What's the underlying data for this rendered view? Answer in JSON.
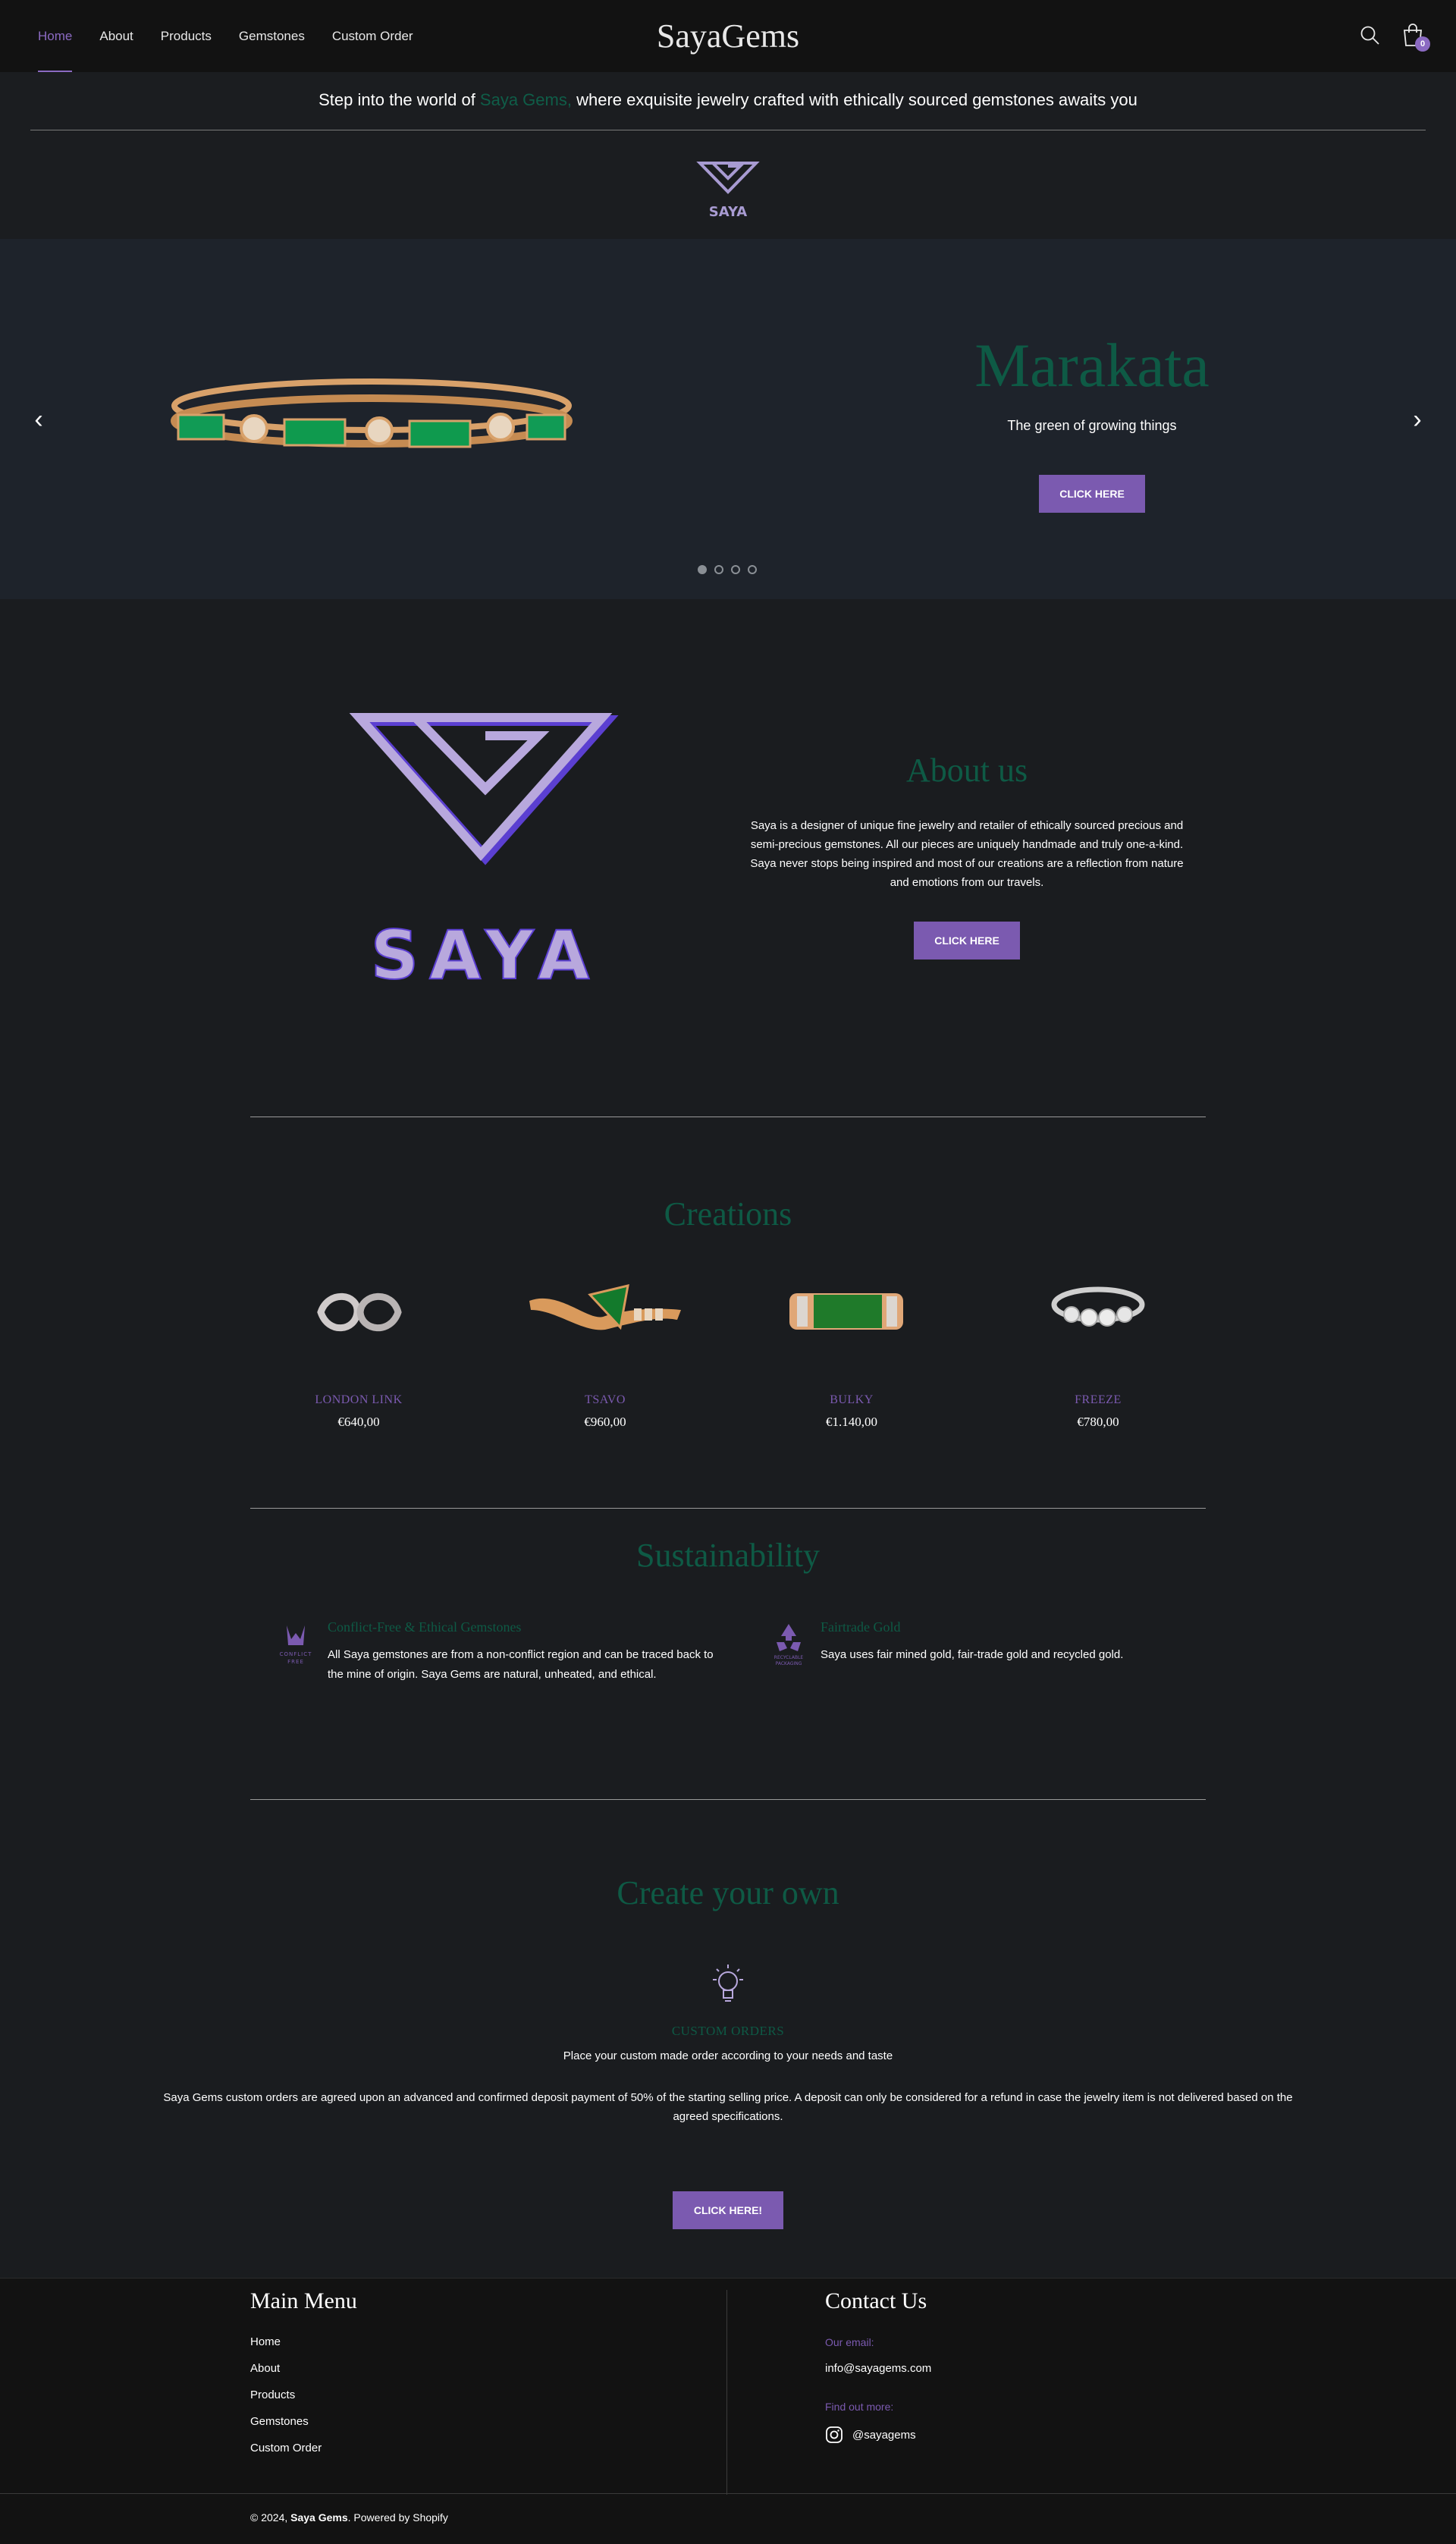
{
  "header": {
    "nav": [
      "Home",
      "About",
      "Products",
      "Gemstones",
      "Custom Order"
    ],
    "brand": "SayaGems",
    "cart_count": "0",
    "icons": [
      "search-icon",
      "cart-icon"
    ]
  },
  "announcement": {
    "pre": "Step into the world of ",
    "highlight": "Saya Gems,",
    "post": " where exquisite jewelry crafted with ethically sourced gemstones awaits you",
    "logo_text": "SAYA"
  },
  "slider": {
    "title": "Marakata",
    "subtitle": "The green of growing things",
    "button": "CLICK HERE",
    "slide_count": 4,
    "active_slide": 1
  },
  "about": {
    "logo_text": "SAYA",
    "title": "About us",
    "text": "Saya is a designer of unique fine jewelry and retailer of ethically sourced precious and semi-precious gemstones. All our pieces are uniquely handmade and truly one-a-kind. Saya never stops being inspired and most of our creations are a reflection from nature and emotions from our travels.",
    "button": "CLICK HERE"
  },
  "creations": {
    "title": "Creations",
    "products": [
      {
        "name": "LONDON LINK",
        "price": "€640,00"
      },
      {
        "name": "TSAVO",
        "price": "€960,00"
      },
      {
        "name": "BULKY",
        "price": "€1.140,00"
      },
      {
        "name": "FREEZE",
        "price": "€780,00"
      }
    ]
  },
  "sustainability": {
    "title": "Sustainability",
    "items": [
      {
        "icon_label": "CONFLICT FREE",
        "heading": "Conflict-Free & Ethical Gemstones",
        "text": "All Saya gemstones are from a non-conflict region and can be traced back to the mine of origin. Saya Gems are natural, unheated, and ethical."
      },
      {
        "icon_label": "RECYCLABLE PACKAGING",
        "heading": "Fairtrade Gold",
        "text": "Saya uses fair mined gold, fair-trade gold and recycled gold."
      }
    ]
  },
  "create_own": {
    "title": "Create your own",
    "heading": "CUSTOM ORDERS",
    "subtitle": "Place your custom made order according to your needs and taste",
    "text": "Saya Gems custom orders are agreed upon an advanced and confirmed deposit payment of 50% of the starting selling price. A deposit can only be considered for a refund in case the jewelry item is not delivered based on the agreed specifications.",
    "button": "CLICK HERE!"
  },
  "footer": {
    "menu_title": "Main Menu",
    "menu": [
      "Home",
      "About",
      "Products",
      "Gemstones",
      "Custom Order"
    ],
    "contact_title": "Contact Us",
    "email_label": "Our email:",
    "email": "info@sayagems.com",
    "more_label": "Find out more:",
    "instagram": "@sayagems",
    "copyright_pre": "© 2024, ",
    "copyright_brand": "Saya Gems",
    "copyright_post": ". Powered by Shopify"
  },
  "colors": {
    "accent_purple": "#7b5ab0",
    "heading_green": "#0e5a45",
    "background": "#1a1c1f"
  }
}
